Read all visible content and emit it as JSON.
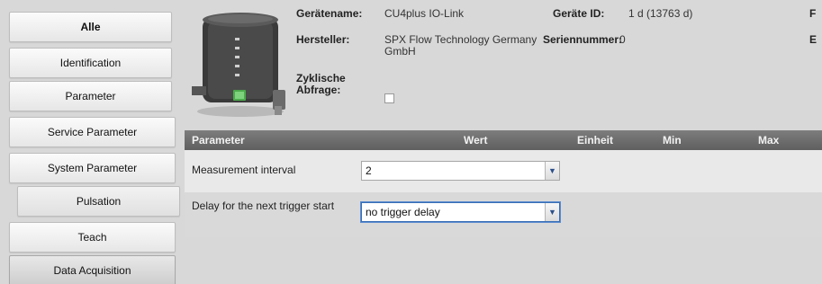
{
  "sidebar": {
    "items": [
      {
        "label": "Alle"
      },
      {
        "label": "Identification"
      },
      {
        "label": "Parameter"
      },
      {
        "label": "Service Parameter"
      },
      {
        "label": "System Parameter"
      },
      {
        "label": "Pulsation"
      },
      {
        "label": "Teach"
      },
      {
        "label": "Data Acquisition"
      }
    ]
  },
  "device": {
    "name_label": "Gerätename:",
    "name_value": "CU4plus IO-Link",
    "id_label": "Geräte ID:",
    "id_value": "1 d (13763 d)",
    "manufacturer_label": "Hersteller:",
    "manufacturer_value": "SPX Flow Technology Germany GmbH",
    "serial_label": "Seriennummer:",
    "serial_value": "0",
    "cyclic_label": "Zyklische Abfrage:",
    "cyclic_checked": false,
    "cut_right_1": "F",
    "cut_right_2": "E"
  },
  "table": {
    "headers": {
      "parameter": "Parameter",
      "value": "Wert",
      "unit": "Einheit",
      "min": "Min",
      "max": "Max"
    },
    "rows": [
      {
        "label": "Measurement interval",
        "value": "2"
      },
      {
        "label": "Delay for the next trigger start",
        "value": "no trigger delay"
      }
    ]
  }
}
